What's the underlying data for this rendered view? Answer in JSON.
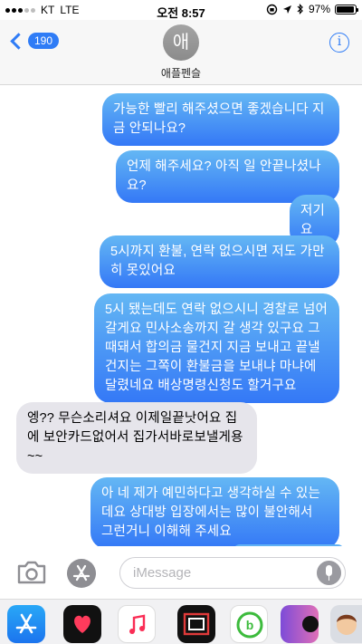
{
  "status_bar": {
    "carrier": "KT",
    "network": "LTE",
    "time": "오전 8:57",
    "battery": "97%",
    "battery_level": 0.97
  },
  "header": {
    "back_count": "190",
    "avatar_initial": "애",
    "contact_name": "애플펜슬"
  },
  "messages": [
    {
      "direction": "outgoing",
      "text": "가능한 빨리 해주셨으면 좋겠습니다 지금 안되나요?"
    },
    {
      "direction": "outgoing",
      "text": "언제 해주세요? 아직 일 안끝나셨나요?"
    },
    {
      "direction": "outgoing",
      "text": "저기요"
    },
    {
      "direction": "outgoing",
      "text": "5시까지 환불, 연락 없으시면 저도 가만히 못있어요"
    },
    {
      "direction": "outgoing",
      "text": "5시 됐는데도 연락 없으시니 경찰로 넘어갈게요 민사소송까지 갈 생각 있구요 그때돼서 합의금 물건지 지금 보내고 끝낼건지는 그쪽이 환불금을 보내냐 마냐에 달렸네요 배상명령신청도 할거구요"
    },
    {
      "direction": "incoming",
      "text": "엥?? 무슨소리셔요 이제일끝낫어요 집에 보안카드없어서 집가서바로보낼게용 ~~"
    },
    {
      "direction": "outgoing",
      "text": "아 네 제가 예민하다고 생각하실 수 있는데요 상대방 입장에서는 많이 불안해서 그런거니 이해해 주세요"
    }
  ],
  "composer": {
    "placeholder": "iMessage"
  },
  "app_drawer": [
    "app-store-icon",
    "heart-digital-touch-icon",
    "music-icon",
    "photo-frame-app-icon",
    "beats-app-icon",
    "partial-app-icon",
    "memoji-sticker-icon"
  ]
}
